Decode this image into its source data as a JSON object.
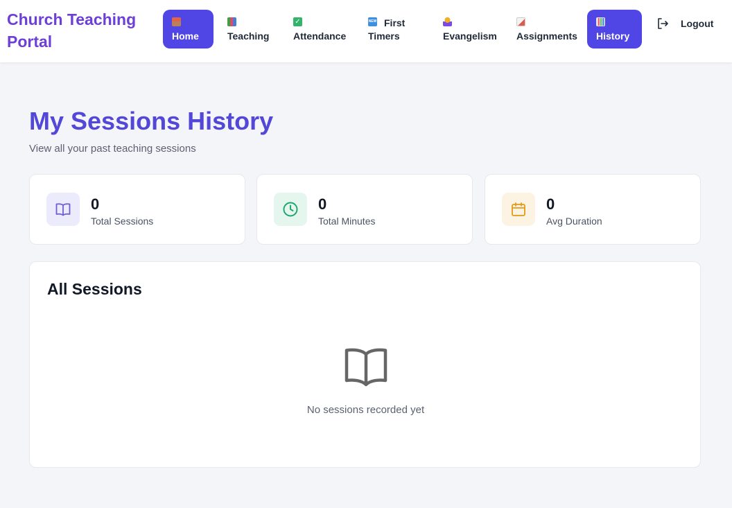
{
  "brand": {
    "line1": "Church Teaching",
    "line2": "Portal"
  },
  "nav": {
    "items": [
      {
        "label": "Home",
        "icon": "house-icon",
        "active": true
      },
      {
        "label": "Teaching",
        "icon": "books-icon",
        "active": false
      },
      {
        "label": "Attendance",
        "icon": "checkmark-icon",
        "active": false
      },
      {
        "label_line1": "First",
        "label_line2": "Timers",
        "icon": "new-badge-icon",
        "active": false
      },
      {
        "label": "Evangelism",
        "icon": "praying-hands-icon",
        "active": false
      },
      {
        "label": "Assignments",
        "icon": "memo-icon",
        "active": false
      },
      {
        "label": "History",
        "icon": "bar-chart-icon",
        "active": true
      }
    ],
    "logout_label": "Logout",
    "new_badge_text": "NEW"
  },
  "page": {
    "title": "My Sessions History",
    "subtitle": "View all your past teaching sessions"
  },
  "stats": [
    {
      "value": "0",
      "label": "Total Sessions",
      "icon": "book-open-icon",
      "color": "#6d5dd3",
      "bg": "#ecebfb"
    },
    {
      "value": "0",
      "label": "Total Minutes",
      "icon": "clock-icon",
      "color": "#1aa56a",
      "bg": "#e5f6ee"
    },
    {
      "value": "0",
      "label": "Avg Duration",
      "icon": "calendar-icon",
      "color": "#e39a17",
      "bg": "#fdf3e3"
    }
  ],
  "sessions": {
    "title": "All Sessions",
    "empty_message": "No sessions recorded yet"
  },
  "colors": {
    "accent": "#4f46e5",
    "brand": "#6d3fd6",
    "title": "#5347d8"
  }
}
